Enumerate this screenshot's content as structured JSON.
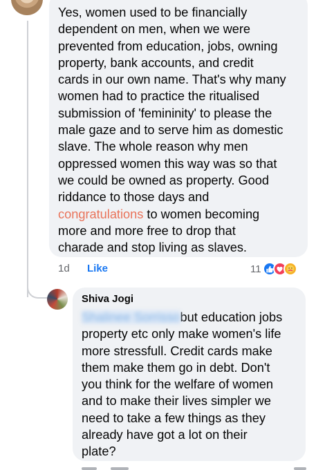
{
  "comment_1": {
    "lines": [
      "Yes, women used to be financially",
      "dependent on men, when we were",
      "prevented from education, jobs, owning",
      "property, bank accounts, and credit",
      "cards in our own name. That's why many",
      "women had to practice the ritualised",
      "submission of 'femininity' to please the",
      "male gaze and to serve him as domestic",
      "slave. The whole reason why men",
      "oppressed women this way was so that",
      "we could be owned as property.  Good",
      "riddance to those days and"
    ],
    "link_word": "congratulations",
    "after_link": " to women becoming",
    "lines_end": [
      "more and more free to drop that",
      "charade and stop living as slaves."
    ],
    "time": "1d",
    "like_label": "Like",
    "reaction_count": "11",
    "reactions": [
      "like-icon",
      "love-icon",
      "care-icon"
    ]
  },
  "reply_1": {
    "author": "Shiva Jogi",
    "mention": "Shalinee Sorrisso",
    "first_line_rest": "but education jobs",
    "lines": [
      "property etc only make women's life",
      "more stressfull. Credit cards make",
      "them make them go in debt. Don't",
      "you think for the welfare of women",
      "and to make their lives simpler we",
      "need to take a few things as they",
      "already have got a lot on their",
      "plate?"
    ]
  },
  "colors": {
    "bubble": "#f0f2f5",
    "link": "#e9735a",
    "like_blue": "#1877f2",
    "meta_gray": "#65676b"
  }
}
